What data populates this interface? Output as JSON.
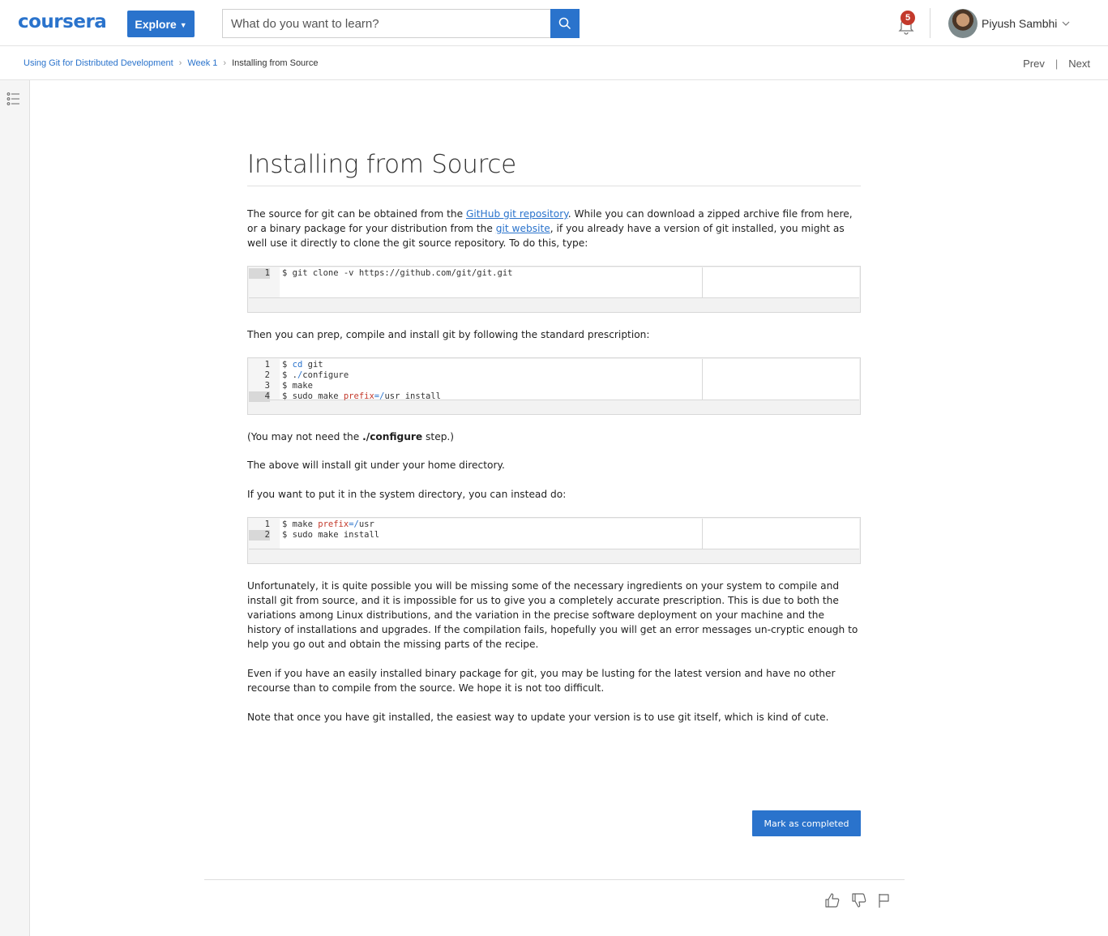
{
  "header": {
    "logo": "coursera",
    "explore_label": "Explore",
    "search_placeholder": "What do you want to learn?",
    "notification_count": "5",
    "user_name": "Piyush Sambhi"
  },
  "breadcrumb": {
    "items": [
      "Using Git for Distributed Development",
      "Week 1",
      "Installing from Source"
    ],
    "prev": "Prev",
    "next": "Next",
    "separator": "|"
  },
  "article": {
    "title": "Installing from Source",
    "p1_a": "The source for git can be obtained from the ",
    "p1_link1": "GitHub git repository",
    "p1_b": ". While you can download a zipped archive file from here, or a binary package for your distribution from the ",
    "p1_link2": "git website",
    "p1_c": ", if you already have a version of git installed, you might as well use it directly to clone the git source repository. To do this, type:",
    "code1": [
      "$ git clone -v https://github.com/git/git.git"
    ],
    "p2": "Then you can prep, compile and install git by following the standard prescription:",
    "code2": [
      "$ cd git",
      "$ ./configure",
      "$ make",
      "$ sudo make prefix=/usr install"
    ],
    "p3_a": "(You may not need the ",
    "p3_bold": "./configure",
    "p3_b": " step.)",
    "p4": "The above will install git under your home directory.",
    "p5": "If you want to put it in the system directory, you can instead do:",
    "code3": [
      "$ make prefix=/usr",
      "$ sudo make install"
    ],
    "p6": "Unfortunately, it is quite possible you will be missing some of the necessary ingredients on your system to compile and install git from source, and it is impossible for us to give you a completely accurate prescription. This is due to both the variations among Linux distributions, and the variation in the precise software deployment on your machine and the history of installations and upgrades. If the compilation fails, hopefully you will get an error messages un-cryptic enough to help you go out and obtain the missing parts of the recipe.",
    "p7": "Even if you have an easily installed binary package for git, you may be lusting for the latest version and have no other recourse than to compile from the source. We hope it is not too difficult.",
    "p8": "Note that once you have git installed, the easiest way to update your version is to use git itself, which is kind of cute.",
    "mark_completed": "Mark as completed"
  },
  "colors": {
    "brand": "#2a73cc",
    "badge": "#c3392b"
  }
}
